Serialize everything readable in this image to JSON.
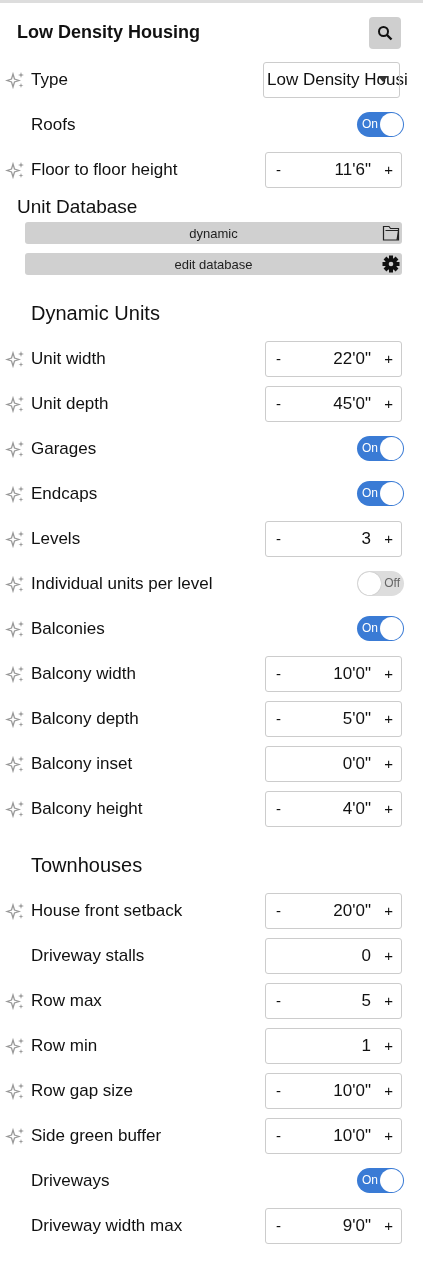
{
  "panel": {
    "title": "Low Density Housing"
  },
  "top_rows": [
    {
      "kind": "dropdown",
      "label": "Type",
      "sparkle": true,
      "value": "Low Density Housi"
    },
    {
      "kind": "toggle",
      "label": "Roofs",
      "sparkle": false,
      "on": true,
      "state_text": "On"
    },
    {
      "kind": "stepper",
      "label": "Floor to floor height",
      "sparkle": true,
      "minus": "-",
      "value": "11'6\"",
      "plus": "+"
    }
  ],
  "unit_database": {
    "heading": "Unit Database",
    "buttons": [
      {
        "label": "dynamic"
      },
      {
        "label": "edit database"
      }
    ]
  },
  "sections": [
    {
      "heading": "Dynamic Units",
      "rows": [
        {
          "kind": "stepper",
          "label": "Unit width",
          "sparkle": true,
          "minus": "-",
          "value": "22'0\"",
          "plus": "+"
        },
        {
          "kind": "stepper",
          "label": "Unit depth",
          "sparkle": true,
          "minus": "-",
          "value": "45'0\"",
          "plus": "+"
        },
        {
          "kind": "toggle",
          "label": "Garages",
          "sparkle": true,
          "on": true,
          "state_text": "On"
        },
        {
          "kind": "toggle",
          "label": "Endcaps",
          "sparkle": true,
          "on": true,
          "state_text": "On"
        },
        {
          "kind": "stepper",
          "label": "Levels",
          "sparkle": true,
          "minus": "-",
          "value": "3",
          "plus": "+"
        },
        {
          "kind": "toggle",
          "label": "Individual units per level",
          "sparkle": true,
          "on": false,
          "state_text": "Off"
        },
        {
          "kind": "toggle",
          "label": "Balconies",
          "sparkle": true,
          "on": true,
          "state_text": "On"
        },
        {
          "kind": "stepper",
          "label": "Balcony width",
          "sparkle": true,
          "minus": "-",
          "value": "10'0\"",
          "plus": "+"
        },
        {
          "kind": "stepper",
          "label": "Balcony depth",
          "sparkle": true,
          "minus": "-",
          "value": "5'0\"",
          "plus": "+"
        },
        {
          "kind": "stepper",
          "label": "Balcony inset",
          "sparkle": true,
          "value": "0'0\"",
          "plus": "+"
        },
        {
          "kind": "stepper",
          "label": "Balcony height",
          "sparkle": true,
          "minus": "-",
          "value": "4'0\"",
          "plus": "+"
        }
      ]
    },
    {
      "heading": "Townhouses",
      "rows": [
        {
          "kind": "stepper",
          "label": "House front setback",
          "sparkle": true,
          "minus": "-",
          "value": "20'0\"",
          "plus": "+"
        },
        {
          "kind": "stepper",
          "label": "Driveway stalls",
          "sparkle": false,
          "value": "0",
          "plus": "+"
        },
        {
          "kind": "stepper",
          "label": "Row max",
          "sparkle": true,
          "minus": "-",
          "value": "5",
          "plus": "+"
        },
        {
          "kind": "stepper",
          "label": "Row min",
          "sparkle": true,
          "value": "1",
          "plus": "+"
        },
        {
          "kind": "stepper",
          "label": "Row gap size",
          "sparkle": true,
          "minus": "-",
          "value": "10'0\"",
          "plus": "+"
        },
        {
          "kind": "stepper",
          "label": "Side green buffer",
          "sparkle": true,
          "minus": "-",
          "value": "10'0\"",
          "plus": "+"
        },
        {
          "kind": "toggle",
          "label": "Driveways",
          "sparkle": false,
          "on": true,
          "state_text": "On"
        },
        {
          "kind": "stepper",
          "label": "Driveway width max",
          "sparkle": false,
          "minus": "-",
          "value": "9'0\"",
          "plus": "+"
        }
      ]
    }
  ]
}
